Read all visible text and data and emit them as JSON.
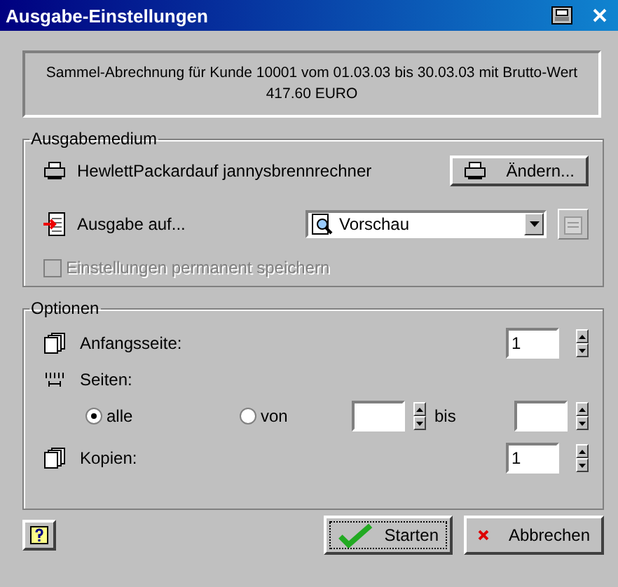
{
  "window": {
    "title": "Ausgabe-Einstellungen"
  },
  "summary": {
    "line_1": "Sammel-Abrechnung für Kunde 10001  vom 01.03.03 bis 30.03.03 mit Brutto-Wert",
    "line_2": "417.60 EURO"
  },
  "ausgabemedium": {
    "legend": "Ausgabemedium",
    "printer": "HewlettPackardauf jannysbrennrechner",
    "change_button": "Ändern...",
    "output_label": "Ausgabe auf...",
    "output_select": {
      "value": "Vorschau"
    },
    "save_checkbox": {
      "label": "Einstellungen permanent speichern",
      "checked": false,
      "disabled": true
    }
  },
  "optionen": {
    "legend": "Optionen",
    "start_page": {
      "label": "Anfangsseite:",
      "value": "1"
    },
    "pages": {
      "label": "Seiten:",
      "options": [
        {
          "label": "alle",
          "selected": true
        },
        {
          "label": "von",
          "selected": false
        }
      ],
      "to_label": "bis"
    },
    "copies": {
      "label": "Kopien:",
      "value": "1"
    }
  },
  "buttons": [
    {
      "kind": "start",
      "label": "Starten"
    },
    {
      "kind": "cancel",
      "label": "Abbrechen"
    }
  ]
}
